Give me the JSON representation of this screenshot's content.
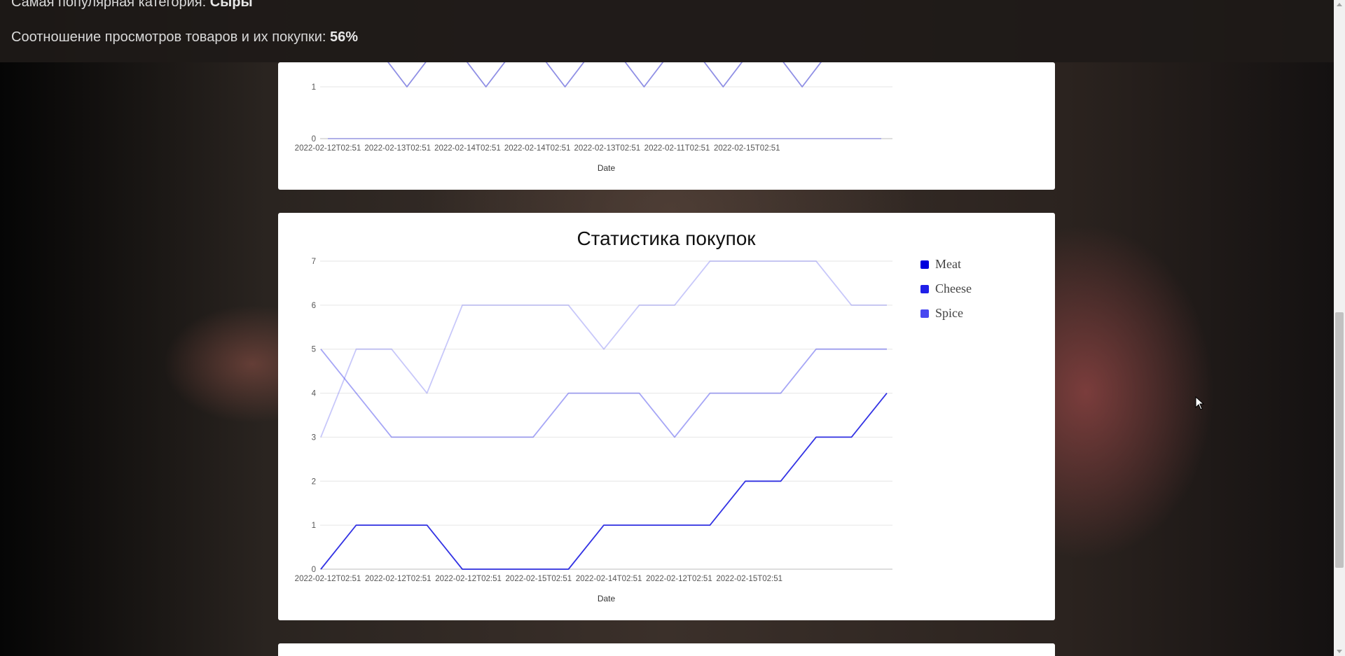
{
  "header": {
    "popular_category_label": "Самая популярная категория:",
    "popular_category_value": "Сыры",
    "ratio_label": "Соотношение просмотров товаров и их покупки:",
    "ratio_value": "56%"
  },
  "chart_data": [
    {
      "type": "line",
      "title": "",
      "xlabel": "Date",
      "ylabel": "",
      "categories": [
        "2022-02-12T02:51",
        "",
        "2022-02-13T02:51",
        "",
        "2022-02-14T02:51",
        "",
        "2022-02-14T02:51",
        "",
        "2022-02-13T02:51",
        "",
        "2022-02-11T02:51",
        "",
        "2022-02-15T02:51",
        "",
        ""
      ],
      "visible_y_ticks": [
        0,
        1
      ],
      "series": [
        {
          "color": "#7b7be0",
          "values": [
            null,
            2,
            1,
            2,
            1,
            2,
            1,
            2,
            1,
            2,
            1,
            2,
            1,
            2,
            null
          ]
        },
        {
          "color": "#9b9be8",
          "values": [
            0,
            0,
            0,
            0,
            0,
            0,
            0,
            0,
            0,
            0,
            0,
            0,
            0,
            0,
            0
          ]
        }
      ],
      "ylim": [
        0,
        2
      ],
      "grid": true
    },
    {
      "type": "line",
      "title": "Статистика покупок",
      "xlabel": "Date",
      "ylabel": "",
      "categories": [
        "2022-02-12T02:51",
        "",
        "2022-02-12T02:51",
        "",
        "2022-02-12T02:51",
        "",
        "2022-02-15T02:51",
        "",
        "2022-02-14T02:51",
        "",
        "2022-02-12T02:51",
        "",
        "2022-02-15T02:51",
        "",
        ""
      ],
      "y_ticks": [
        0,
        1,
        2,
        3,
        4,
        5,
        6,
        7
      ],
      "ylim": [
        0,
        7
      ],
      "legend_position": "right",
      "grid": true,
      "series": [
        {
          "name": "Meat",
          "color": "#0000dd",
          "values": [
            0,
            1,
            1,
            1,
            0,
            0,
            0,
            0,
            1,
            1,
            1,
            1,
            2,
            2,
            3,
            3,
            4
          ]
        },
        {
          "name": "Cheese",
          "color": "#2020e8",
          "values": [
            5,
            4,
            3,
            3,
            3,
            3,
            3,
            4,
            4,
            4,
            3,
            4,
            4,
            4,
            5,
            5,
            5
          ]
        },
        {
          "name": "Spice",
          "color": "#4848f0",
          "values": [
            3,
            5,
            5,
            4,
            6,
            6,
            6,
            6,
            5,
            6,
            6,
            7,
            7,
            7,
            7,
            6,
            6
          ]
        }
      ]
    }
  ]
}
